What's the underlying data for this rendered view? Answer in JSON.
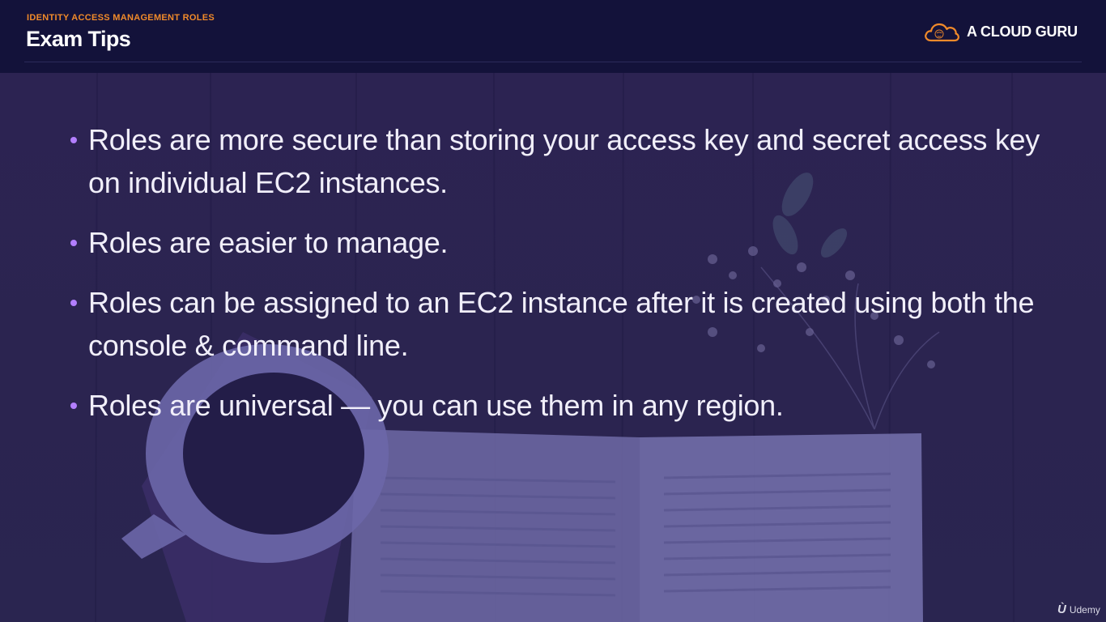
{
  "header": {
    "eyebrow": "IDENTITY ACCESS MANAGEMENT ROLES",
    "title": "Exam Tips",
    "brand": {
      "name": "A CLOUD GURU",
      "icon": "cloud-guru-logo-icon",
      "accent_color": "#f08a2a"
    }
  },
  "bullets": [
    {
      "text": "Roles are more secure than storing your access key and secret access key on individual EC2 instances."
    },
    {
      "text": "Roles are easier to manage."
    },
    {
      "text": "Roles can be assigned to an EC2 instance after it is created using both the console & command line."
    },
    {
      "text": "Roles are universal — you can use them in any region."
    }
  ],
  "watermark": {
    "icon": "udemy-logo-icon",
    "label": "Udemy"
  },
  "colors": {
    "header_bg": "#13123a",
    "bullet_dot": "#b37fff",
    "body_text": "#f1effa"
  }
}
